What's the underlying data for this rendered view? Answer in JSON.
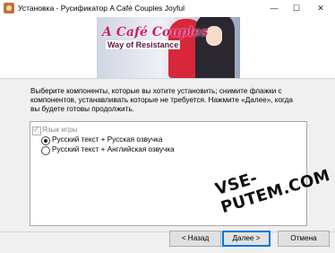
{
  "window": {
    "title": "Установка - Русификатор A Café Couples Joyful",
    "min_glyph": "—",
    "max_glyph": "☐",
    "close_glyph": "✕"
  },
  "banner": {
    "logo_line1": "A Café Couples",
    "logo_line2": "Way of Resistance"
  },
  "description": "Выберите компоненты, которые вы хотите установить; снимите флажки с компонентов, устанавливать которые не требуется. Нажмите «Далее», когда вы будете готовы продолжить.",
  "components": {
    "group_label": "Язык игры",
    "options": [
      {
        "label": "Русский текст + Русская озвучка",
        "selected": true
      },
      {
        "label": "Русский текст + Английская озвучка",
        "selected": false
      }
    ]
  },
  "watermark": "VSE-PUTEM.COM",
  "buttons": {
    "back": "< Назад",
    "next": "Далее >",
    "cancel": "Отмена"
  },
  "colors": {
    "accent": "#0078d7",
    "logo": "#d21c63"
  }
}
